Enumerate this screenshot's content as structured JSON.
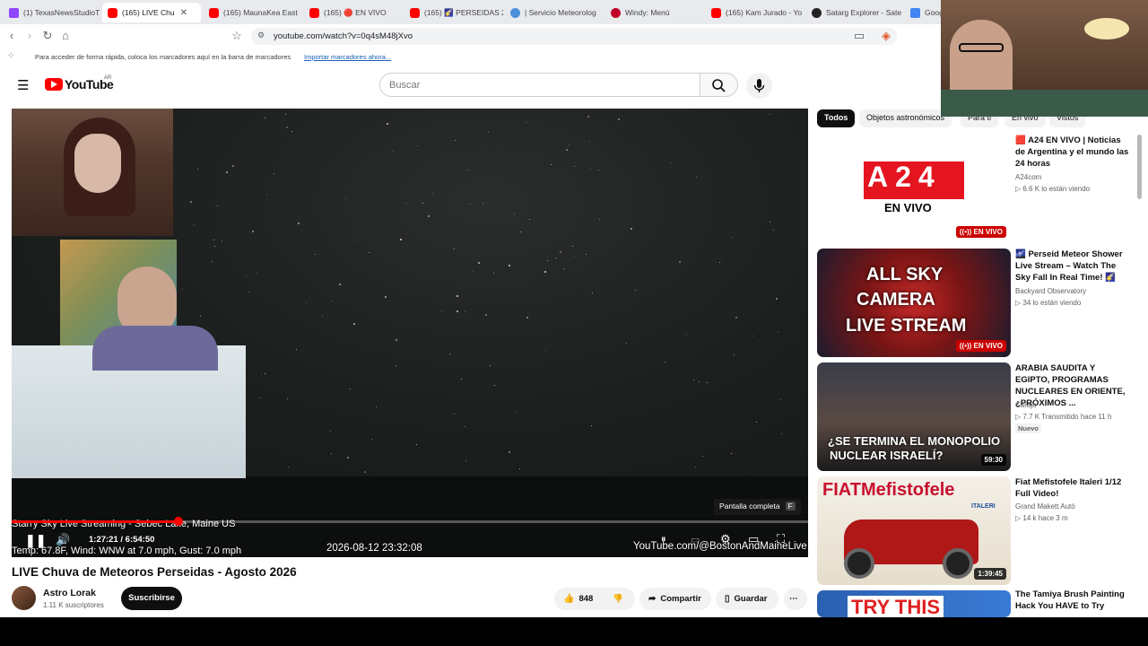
{
  "browser": {
    "tabs": [
      {
        "label": "(1) TexasNewsStudioT",
        "icon": "twitch-icon"
      },
      {
        "label": "(165) LIVE Chu",
        "icon": "youtube-icon",
        "active": true
      },
      {
        "label": "(165) MaunaKea East",
        "icon": "youtube-icon"
      },
      {
        "label": "(165) 🔴 EN VIVO",
        "icon": "youtube-icon"
      },
      {
        "label": "(165) 🌠 PERSEIDAS 2",
        "icon": "youtube-icon"
      },
      {
        "label": "| Servicio Meteorolog",
        "icon": "smn-icon"
      },
      {
        "label": "Windy: Menú",
        "icon": "windy-icon"
      },
      {
        "label": "(165) Kam Jurado - Yo",
        "icon": "youtube-icon"
      },
      {
        "label": "Satarg Explorer - Sate",
        "icon": "satarg-icon"
      },
      {
        "label": "Goog",
        "icon": "google-icon"
      }
    ],
    "url": "youtube.com/watch?v=0q4sM48jXvo",
    "bookmarks_text": "Para acceder de forma rápida, coloca los marcadores aquí en la barra de marcadores",
    "bookmarks_link": "Importar marcadores ahora..."
  },
  "youtube": {
    "logo_text": "YouTube",
    "country": "AR",
    "search_placeholder": "Buscar"
  },
  "player": {
    "overlay_title": "Starry Sky Live Streaming - Sebec Lake, Maine US",
    "overlay_weather": "Temp: 67.8F, Wind: WNW at 7.0 mph, Gust: 7.0 mph",
    "overlay_datetime": "2026-08-12 23:32:08",
    "overlay_credit": "YouTube.com/@BostonAndMaineLive",
    "time_current": "1:27:21",
    "time_sep": " / ",
    "time_total": "6:54:50",
    "progress_fraction": 0.21,
    "tooltip": "Pantalla completa",
    "tooltip_key": "F"
  },
  "video": {
    "title": "LIVE Chuva de Meteoros Perseidas - Agosto 2026",
    "channel": "Astro Lorak",
    "subscribers": "1.11 K suscriptores",
    "subscribe_label": "Suscribirse",
    "likes": "848",
    "share_label": "Compartir",
    "save_label": "Guardar"
  },
  "chips": [
    "Todos",
    "Objetos astronómicos",
    "Para ti",
    "En vivo",
    "Vistos"
  ],
  "recommendations": [
    {
      "title": "🟥 A24 EN VIVO | Noticias de Argentina y el mundo las 24 horas",
      "channel": "A24com",
      "meta": "▷ 6.6 K lo están viendo",
      "badge": "((•)) EN VIVO",
      "thumb_text1": "A24",
      "thumb_text2": "EN VIVO"
    },
    {
      "title": "🌌 Perseid Meteor Shower Live Stream – Watch The Sky Fall In Real Time! 🌠",
      "channel": "Backyard Observatory",
      "meta": "▷ 34 lo están viendo",
      "badge": "((•)) EN VIVO",
      "thumb_text1": "ALL SKY",
      "thumb_text2": "CAMERA",
      "thumb_text3": "LIVE STREAM"
    },
    {
      "title": "ARABIA SAUDITA Y EGIPTO, PROGRAMAS NUCLEARES EN ORIENTE, ¿PRÓXIMOS ...",
      "channel": "Carajo",
      "meta": "▷ 7.7 K  Transmitido hace 11 h",
      "new_badge": "Nuevo",
      "badge": "59:30",
      "thumb_text1": "¿SE TERMINA EL MONOPOLIO",
      "thumb_text2": "NUCLEAR ISRAELÍ?"
    },
    {
      "title": "Fiat Mefistofele Italeri 1/12 Full Video!",
      "channel": "Grand Makett Autó",
      "meta": "▷ 14 k  hace 3 m",
      "badge": "1:39:45",
      "thumb_text1": "FIATMefistofele",
      "thumb_text2": "ITALERI"
    },
    {
      "title": "The Tamiya Brush Painting Hack You HAVE to Try",
      "thumb_text1": "TRY THIS"
    }
  ]
}
